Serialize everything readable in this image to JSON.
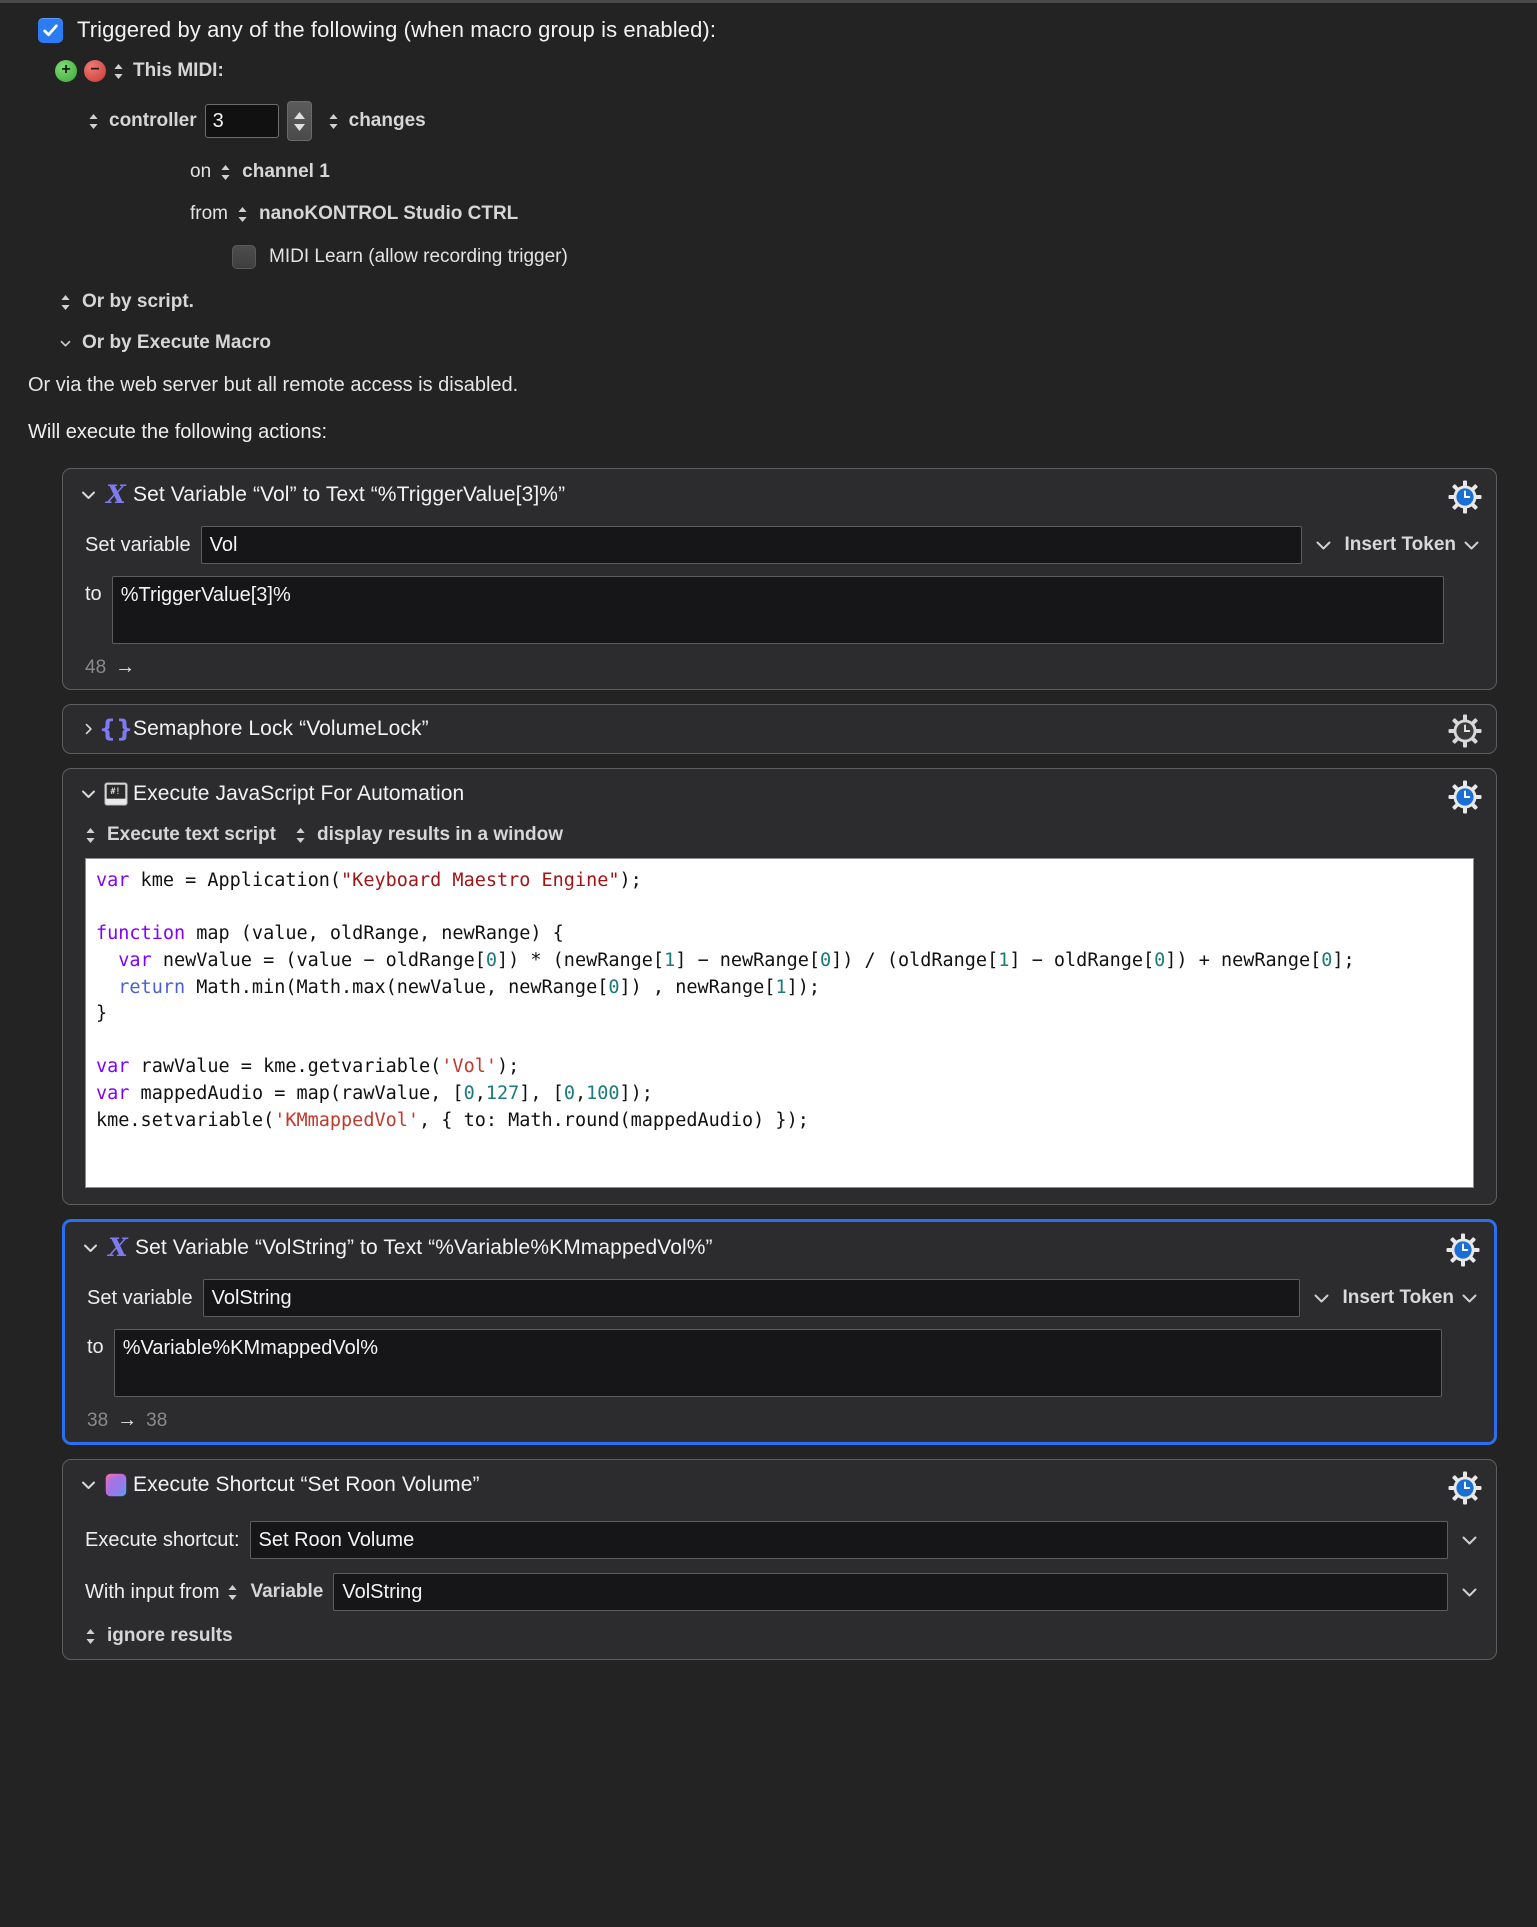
{
  "trigger": {
    "checkbox_checked": true,
    "title": "Triggered by any of the following (when macro group is enabled):",
    "add_button": "+",
    "remove_button": "−",
    "source_label": "This MIDI:",
    "controller_label": "controller",
    "controller_value": "3",
    "changes_label": "changes",
    "on_label": "on",
    "channel_label": "channel 1",
    "from_label": "from",
    "device_label": "nanoKONTROL Studio CTRL",
    "midi_learn_label": "MIDI Learn (allow recording trigger)",
    "midi_learn_checked": false,
    "or_by_script": "Or by script.",
    "or_by_execute_macro": "Or by Execute Macro",
    "web_server_note": "Or via the web server but all remote access is disabled.",
    "will_execute": "Will execute the following actions:"
  },
  "colors": {
    "accent_blue": "#2b7cf4",
    "selection_blue": "#2b6ef0",
    "window_bg": "#232323",
    "action_bg": "#2c2c2e",
    "field_bg": "#161618",
    "code_bg": "#ffffff"
  },
  "actions": [
    {
      "id": "set-variable-vol",
      "icon": "x-variable-icon",
      "title": "Set Variable “Vol” to Text “%TriggerValue[3]%”",
      "expanded": true,
      "selected": false,
      "gear": "gear-blue-clock-icon",
      "set_variable_label": "Set variable",
      "variable_name": "Vol",
      "insert_token_label": "Insert Token",
      "to_label": "to",
      "to_value": "%TriggerValue[3]%",
      "char_count_left": "48",
      "char_count_arrow": "→",
      "char_count_right": ""
    },
    {
      "id": "semaphore-lock",
      "icon": "braces-icon",
      "title": "Semaphore Lock “VolumeLock”",
      "expanded": false,
      "selected": false,
      "gear": "gear-grey-clock-icon"
    },
    {
      "id": "execute-javascript",
      "icon": "script-window-icon",
      "title": "Execute JavaScript For Automation",
      "expanded": true,
      "selected": false,
      "gear": "gear-blue-clock-icon",
      "option_script_source": "Execute text script",
      "option_results": "display results in a window",
      "code_lines": [
        {
          "t": "var ",
          "c": "kw"
        },
        {
          "t": "kme = Application(",
          "c": ""
        },
        {
          "t": "\"Keyboard Maestro Engine\"",
          "c": "str"
        },
        {
          "t": ");",
          "c": ""
        }
      ]
    },
    {
      "id": "set-variable-volstring",
      "icon": "x-variable-icon",
      "title": "Set Variable “VolString” to Text “%Variable%KMmappedVol%”",
      "expanded": true,
      "selected": true,
      "gear": "gear-blue-clock-icon",
      "set_variable_label": "Set variable",
      "variable_name": "VolString",
      "insert_token_label": "Insert Token",
      "to_label": "to",
      "to_value": "%Variable%KMmappedVol%",
      "char_count_left": "38",
      "char_count_arrow": "→",
      "char_count_right": "38"
    },
    {
      "id": "execute-shortcut",
      "icon": "shortcuts-icon",
      "title": "Execute Shortcut “Set Roon Volume”",
      "expanded": true,
      "selected": false,
      "gear": "gear-blue-clock-icon",
      "execute_shortcut_label": "Execute shortcut:",
      "shortcut_name": "Set Roon Volume",
      "with_input_label": "With input from",
      "input_source": "Variable",
      "input_variable": "VolString",
      "ignore_results_label": "ignore results"
    }
  ],
  "script": {
    "language": "JavaScript for Automation",
    "text": "var kme = Application(\"Keyboard Maestro Engine\");\n\nfunction map (value, oldRange, newRange) {\n  var newValue = (value − oldRange[0]) * (newRange[1] − newRange[0]) / (oldRange[1] − oldRange[0]) + newRange[0];\n  return Math.min(Math.max(newValue, newRange[0]) , newRange[1]);\n}\n\nvar rawValue = kme.getvariable('Vol');\nvar mappedAudio = map(rawValue, [0,127], [0,100]);\nkme.setvariable('KMmappedVol', { to: Math.round(mappedAudio) });"
  }
}
